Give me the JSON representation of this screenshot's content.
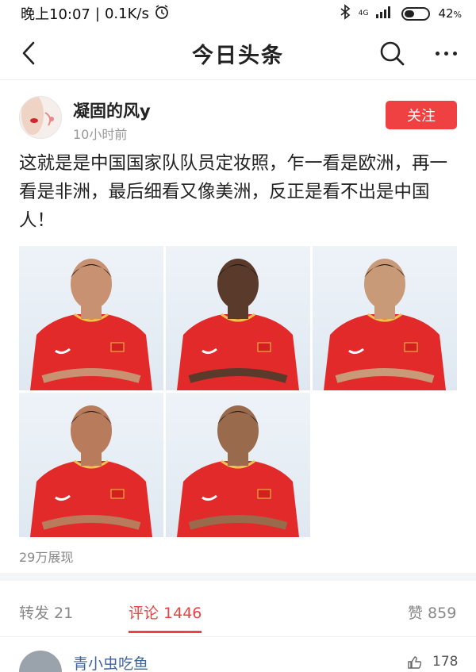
{
  "status_bar": {
    "time": "晚上10:07",
    "speed": "0.1K/s",
    "network": "4G",
    "battery_percent": "42",
    "battery_unit": "%",
    "battery_level": 0.42
  },
  "nav": {
    "title": "今日头条"
  },
  "author": {
    "name": "凝固的风y",
    "time": "10小时前",
    "follow_label": "关注"
  },
  "post": {
    "text": "这就是是中国国家队队员定妆照，乍一看是欧洲，再一看是非洲，最后细看又像美洲，反正是看不出是中国人！",
    "photo_count": 5,
    "view_count": "29万展现"
  },
  "tabs": {
    "repost": "转发 21",
    "comment": "评论 1446",
    "like": "赞 859"
  },
  "comment_preview": {
    "user": "青小虫吃鱼",
    "likes": "178"
  },
  "colors": {
    "accent": "#f04142",
    "jersey": "#e22a2a",
    "link_blue": "#406599"
  }
}
